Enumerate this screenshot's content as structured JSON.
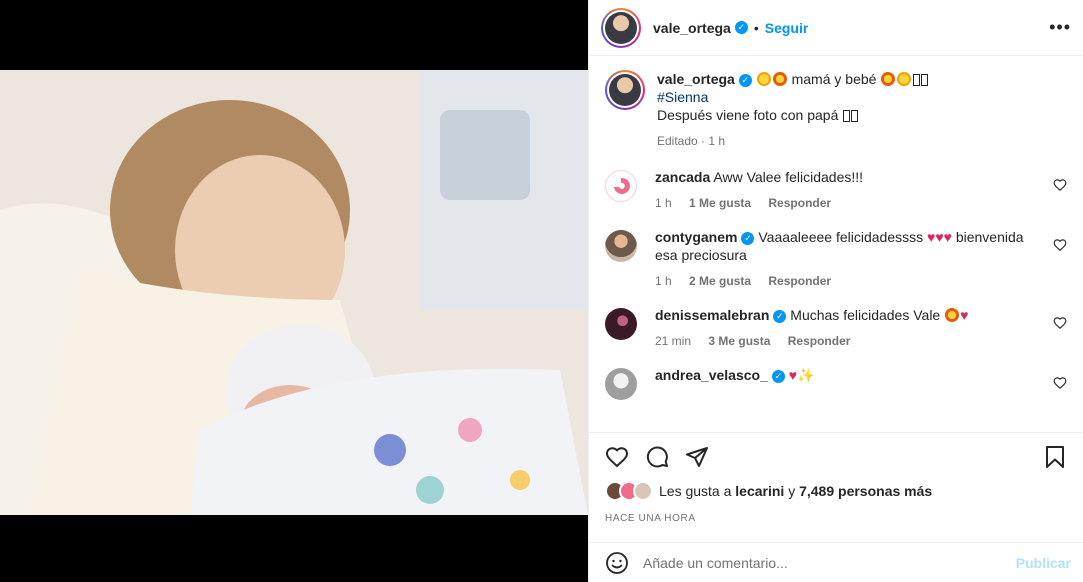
{
  "post": {
    "username": "vale_ortega",
    "follow_label": "Seguir",
    "separator": "•",
    "more_label": "•••"
  },
  "caption": {
    "username": "vale_ortega",
    "text_1": "mamá y bebé",
    "hashtag": "#Sienna",
    "line_2": "Después viene foto con papá",
    "meta": "Editado · 1 h"
  },
  "comments": [
    {
      "username": "zancada",
      "text": "Aww Valee felicidades!!!",
      "time": "1 h",
      "likes": "1 Me gusta",
      "reply": "Responder",
      "verified": false,
      "avatar_color": "#f06a8a"
    },
    {
      "username": "contyganem",
      "text": "Vaaaaleeee felicidadessss",
      "text_after": "bienvenida esa preciosura",
      "time": "1 h",
      "likes": "2 Me gusta",
      "reply": "Responder",
      "verified": true,
      "avatar_color": "#8a6d5a"
    },
    {
      "username": "denissemalebran",
      "text": "Muchas felicidades Vale",
      "time": "21 min",
      "likes": "3 Me gusta",
      "reply": "Responder",
      "verified": true,
      "avatar_color": "#5a2a3a"
    },
    {
      "username": "andrea_velasco_",
      "text": "",
      "time": "",
      "likes": "",
      "reply": "",
      "verified": true,
      "avatar_color": "#bdbdbd"
    }
  ],
  "likes_text": {
    "prefix": "Les gusta a",
    "user": "lecarini",
    "middle": "y",
    "count": "7,489 personas más"
  },
  "time_ago": "Hace una hora",
  "add_comment": {
    "placeholder": "Añade un comentario...",
    "publish_label": "Publicar"
  },
  "colors": {
    "accent": "#0095f6",
    "publish_disabled": "#b2dffc",
    "heart": "#e0245e"
  }
}
